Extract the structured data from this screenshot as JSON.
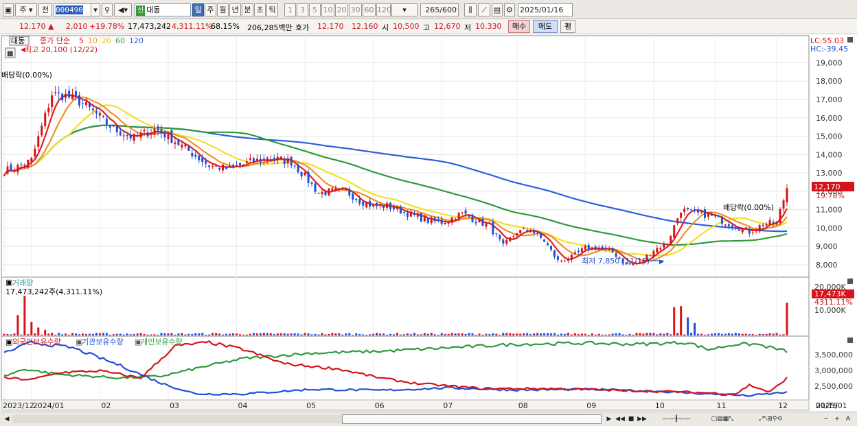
{
  "toolbar": {
    "market": "주",
    "prev_label": "전",
    "code": "000490",
    "tag": "신",
    "name": "대동",
    "periods": [
      "일",
      "주",
      "월",
      "년",
      "분",
      "초",
      "틱"
    ],
    "active_period": "일",
    "intervals": [
      "1",
      "3",
      "5",
      "10",
      "20",
      "30",
      "60",
      "120"
    ],
    "count": "265",
    "count_max": "/600",
    "date": "2025/01/16"
  },
  "quote": {
    "price": "12,170",
    "arrow": "▲",
    "change": "2,010",
    "change_pct": "+19.78%",
    "volume": "17,473,242",
    "vol_ratio": "4,311.11%",
    "strength": "68.15%",
    "amount": "206,285백만",
    "ask_label": "호가",
    "ask": "12,170",
    "bid": "12,160",
    "open_label": "시",
    "open": "10,500",
    "high_label": "고",
    "high": "12,670",
    "low_label": "저",
    "low": "10,330",
    "buy": "매수",
    "sell": "매도",
    "eval": "평"
  },
  "legend": {
    "stock": "대동",
    "title": "종가 단순",
    "ma5": "5",
    "ma10": "10",
    "ma20": "20",
    "ma60": "60",
    "ma120": "120",
    "lc": "LC:55.03",
    "hc": "HC:-39.45",
    "max_label": "최고 20,100 (12/22)",
    "min_label": "최저 7,850 (11/15)",
    "dividend1": "배당락(0.00%)",
    "dividend2": "배당락(0.00%)",
    "price_tag": "12,170",
    "pct_tag": "19.78%"
  },
  "colors": {
    "up": "#d4141a",
    "down": "#1f4fd6",
    "ma5": "#e02020",
    "ma10": "#f0902a",
    "ma20": "#f2e026",
    "ma60": "#2e9a3a",
    "ma120": "#2d5fdc"
  },
  "volume_panel": {
    "title": "거래량",
    "info": "17,473,242주(4,311.11%)",
    "tag": "17,473K",
    "pct": "4311.11%",
    "ticks": [
      "20,000K",
      "10,000K"
    ]
  },
  "holdings_panel": {
    "foreign": "외국인보유수량",
    "inst": "기관보유수량",
    "indiv": "개인보유수량",
    "ticks": [
      "3,500,000",
      "3,000,000",
      "2,500,000"
    ]
  },
  "xaxis": {
    "labels": [
      "2023/12",
      "2024/01",
      "02",
      "03",
      "04",
      "05",
      "06",
      "07",
      "08",
      "09",
      "10",
      "11",
      "12",
      "2025/01",
      "01/16"
    ]
  },
  "chart_data": {
    "type": "candlestick",
    "y_ticks": [
      8000,
      9000,
      10000,
      11000,
      12000,
      13000,
      14000,
      15000,
      16000,
      17000,
      18000,
      19000
    ],
    "ylim": [
      7400,
      20400
    ],
    "volume_ylim": [
      0,
      24000000
    ],
    "holdings_ylim": [
      2100000,
      3800000
    ],
    "price_path": [
      [
        0,
        13100
      ],
      [
        5,
        13400
      ],
      [
        8,
        13700
      ],
      [
        11,
        15500
      ],
      [
        14,
        17300
      ],
      [
        18,
        17200
      ],
      [
        22,
        16900
      ],
      [
        27,
        16200
      ],
      [
        32,
        15400
      ],
      [
        38,
        14900
      ],
      [
        44,
        15400
      ],
      [
        48,
        15000
      ],
      [
        54,
        14200
      ],
      [
        60,
        13400
      ],
      [
        66,
        13200
      ],
      [
        72,
        13600
      ],
      [
        78,
        13800
      ],
      [
        84,
        13600
      ],
      [
        88,
        12800
      ],
      [
        92,
        11900
      ],
      [
        96,
        12000
      ],
      [
        100,
        12000
      ],
      [
        104,
        11500
      ],
      [
        108,
        11200
      ],
      [
        112,
        11200
      ],
      [
        118,
        10800
      ],
      [
        124,
        10400
      ],
      [
        128,
        10300
      ],
      [
        134,
        10800
      ],
      [
        138,
        10400
      ],
      [
        142,
        10100
      ],
      [
        146,
        9000
      ],
      [
        150,
        9800
      ],
      [
        154,
        9900
      ],
      [
        158,
        9300
      ],
      [
        162,
        8200
      ],
      [
        166,
        8400
      ],
      [
        170,
        8900
      ],
      [
        174,
        8900
      ],
      [
        178,
        8700
      ],
      [
        182,
        8000
      ],
      [
        186,
        8100
      ],
      [
        190,
        8800
      ],
      [
        194,
        9200
      ],
      [
        198,
        11000
      ],
      [
        202,
        10800
      ],
      [
        206,
        10700
      ],
      [
        210,
        10400
      ],
      [
        214,
        10100
      ],
      [
        218,
        9800
      ],
      [
        222,
        10200
      ],
      [
        226,
        10300
      ],
      [
        229,
        12170
      ]
    ],
    "n_days": 230,
    "volume_spikes": [
      [
        4,
        9000000
      ],
      [
        6,
        17473000
      ],
      [
        8,
        6000000
      ],
      [
        10,
        3500000
      ],
      [
        12,
        2500000
      ],
      [
        196,
        12500000
      ],
      [
        198,
        13000000
      ],
      [
        200,
        8000000
      ],
      [
        202,
        5500000
      ],
      [
        229,
        14500000
      ]
    ],
    "foreign_path": [
      [
        0,
        2700000
      ],
      [
        8,
        2650000
      ],
      [
        16,
        2850000
      ],
      [
        28,
        2900000
      ],
      [
        40,
        2700000
      ],
      [
        50,
        3600000
      ],
      [
        60,
        3700000
      ],
      [
        70,
        3500000
      ],
      [
        82,
        3100000
      ],
      [
        98,
        2950000
      ],
      [
        110,
        2700000
      ],
      [
        120,
        2550000
      ],
      [
        140,
        2400000
      ],
      [
        160,
        2400000
      ],
      [
        180,
        2350000
      ],
      [
        200,
        2300000
      ],
      [
        214,
        2250000
      ],
      [
        218,
        2500000
      ],
      [
        224,
        2300000
      ],
      [
        229,
        2700000
      ]
    ],
    "inst_path": [
      [
        0,
        3400000
      ],
      [
        8,
        3700000
      ],
      [
        20,
        3550000
      ],
      [
        34,
        3050000
      ],
      [
        46,
        2550000
      ],
      [
        56,
        2250000
      ],
      [
        70,
        2250000
      ],
      [
        90,
        2380000
      ],
      [
        110,
        2350000
      ],
      [
        130,
        2420000
      ],
      [
        150,
        2360000
      ],
      [
        170,
        2380000
      ],
      [
        190,
        2330000
      ],
      [
        206,
        2250000
      ],
      [
        218,
        2200000
      ],
      [
        229,
        2300000
      ]
    ],
    "indiv_path": [
      [
        0,
        2750000
      ],
      [
        6,
        2950000
      ],
      [
        16,
        2800000
      ],
      [
        34,
        2700000
      ],
      [
        46,
        2750000
      ],
      [
        60,
        3050000
      ],
      [
        70,
        3250000
      ],
      [
        90,
        3400000
      ],
      [
        110,
        3450000
      ],
      [
        130,
        3550000
      ],
      [
        150,
        3650000
      ],
      [
        170,
        3680000
      ],
      [
        185,
        3650000
      ],
      [
        200,
        3700000
      ],
      [
        206,
        3500000
      ],
      [
        214,
        3650000
      ],
      [
        220,
        3650000
      ],
      [
        229,
        3450000
      ]
    ]
  }
}
